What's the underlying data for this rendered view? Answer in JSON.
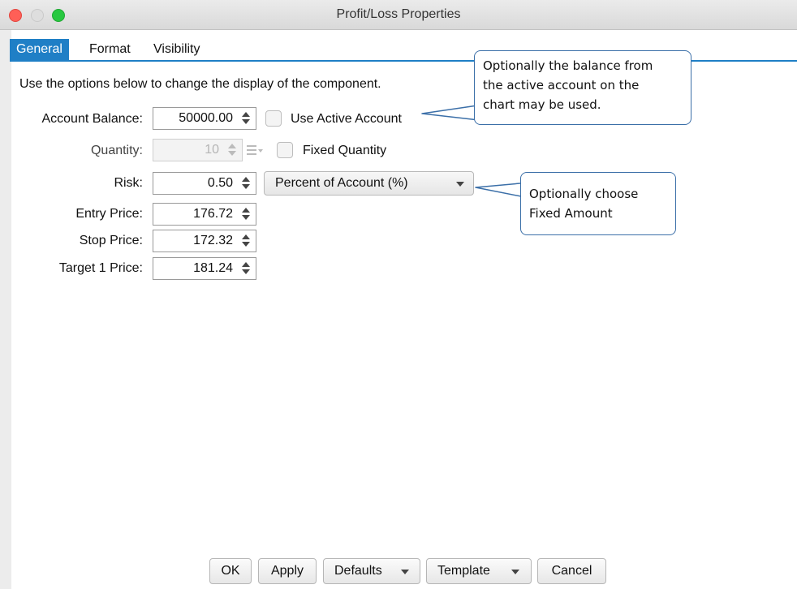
{
  "window": {
    "title": "Profit/Loss Properties"
  },
  "tabs": [
    {
      "label": "General",
      "active": true
    },
    {
      "label": "Format",
      "active": false
    },
    {
      "label": "Visibility",
      "active": false
    }
  ],
  "description": "Use the options below to change the display of the component.",
  "form": {
    "account_balance": {
      "label": "Account Balance:",
      "value": "50000.00"
    },
    "use_active_account": {
      "label": "Use Active Account",
      "checked": false
    },
    "quantity": {
      "label": "Quantity:",
      "value": "10",
      "disabled": true
    },
    "fixed_quantity": {
      "label": "Fixed Quantity",
      "checked": false
    },
    "risk": {
      "label": "Risk:",
      "value": "0.50"
    },
    "risk_type": {
      "selected": "Percent of Account (%)"
    },
    "entry_price": {
      "label": "Entry Price:",
      "value": "176.72"
    },
    "stop_price": {
      "label": "Stop Price:",
      "value": "172.32"
    },
    "target1_price": {
      "label": "Target 1 Price:",
      "value": "181.24"
    }
  },
  "callouts": {
    "balance_note": [
      "Optionally the balance from",
      "the active account on the",
      "chart may be used."
    ],
    "risk_note": [
      "Optionally choose",
      "Fixed Amount"
    ]
  },
  "buttons": {
    "ok": "OK",
    "apply": "Apply",
    "defaults": "Defaults",
    "template": "Template",
    "cancel": "Cancel"
  },
  "colors": {
    "accent": "#1f7fc6",
    "close": "#ff5f57",
    "maximize": "#28c840",
    "callout_border": "#3b6fa8"
  }
}
